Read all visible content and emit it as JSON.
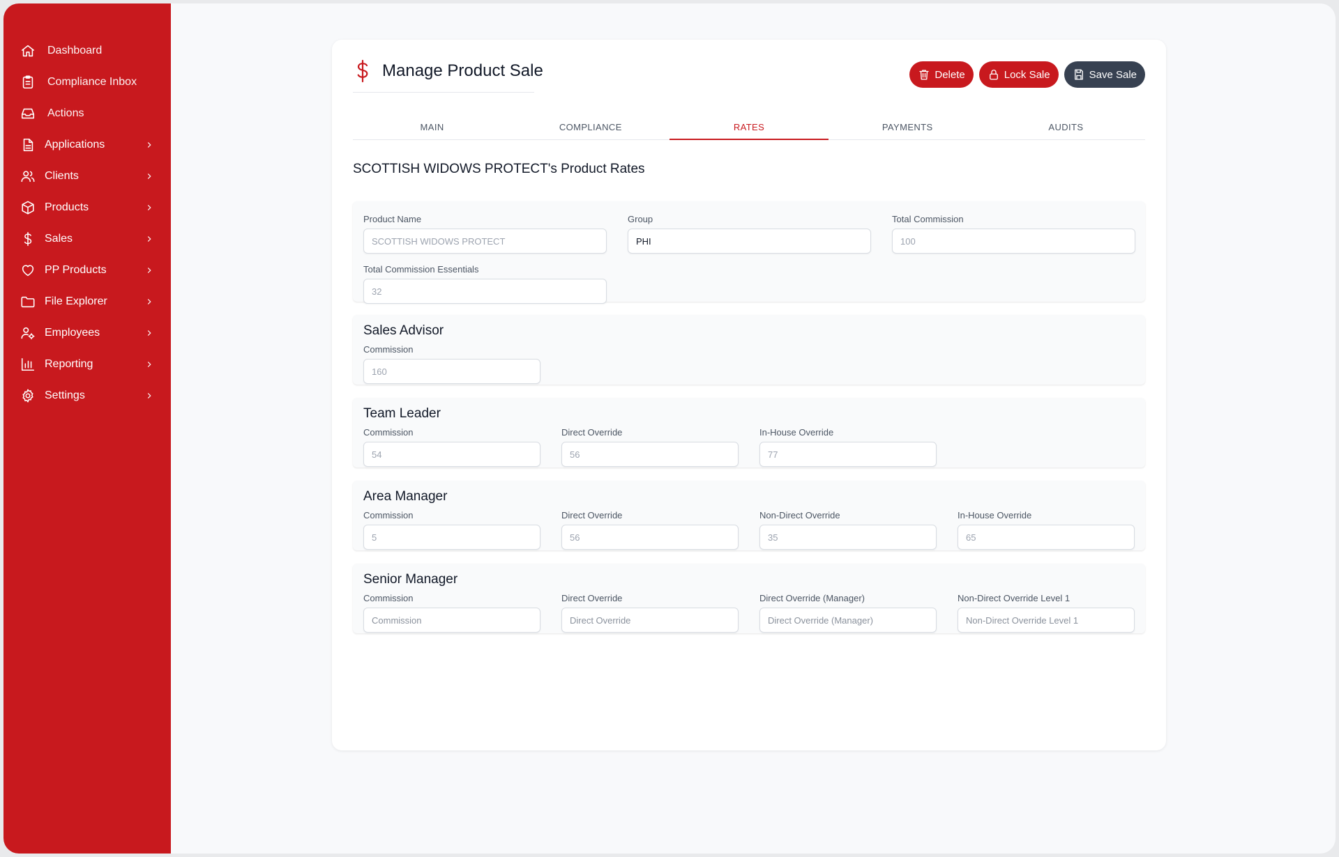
{
  "sidebar": {
    "items": [
      {
        "label": "Dashboard",
        "icon": "home-icon",
        "has_children": false
      },
      {
        "label": "Compliance Inbox",
        "icon": "clipboard-icon",
        "has_children": false
      },
      {
        "label": "Actions",
        "icon": "inbox-icon",
        "has_children": false
      },
      {
        "label": "Applications",
        "icon": "document-icon",
        "has_children": true
      },
      {
        "label": "Clients",
        "icon": "users-icon",
        "has_children": true
      },
      {
        "label": "Products",
        "icon": "cube-icon",
        "has_children": true
      },
      {
        "label": "Sales",
        "icon": "dollar-icon",
        "has_children": true
      },
      {
        "label": "PP Products",
        "icon": "heart-icon",
        "has_children": true
      },
      {
        "label": "File Explorer",
        "icon": "folder-icon",
        "has_children": true
      },
      {
        "label": "Employees",
        "icon": "user-cog-icon",
        "has_children": true
      },
      {
        "label": "Reporting",
        "icon": "bar-chart-icon",
        "has_children": true
      },
      {
        "label": "Settings",
        "icon": "gear-icon",
        "has_children": true
      }
    ]
  },
  "header": {
    "title": "Manage Product Sale",
    "icon": "dollar-icon",
    "buttons": {
      "delete": "Delete",
      "lock": "Lock Sale",
      "save": "Save Sale"
    }
  },
  "tabs": [
    {
      "label": "MAIN",
      "active": false
    },
    {
      "label": "COMPLIANCE",
      "active": false
    },
    {
      "label": "RATES",
      "active": true
    },
    {
      "label": "PAYMENTS",
      "active": false
    },
    {
      "label": "AUDITS",
      "active": false
    }
  ],
  "section_title": "SCOTTISH WIDOWS PROTECT's Product Rates",
  "product": {
    "name_label": "Product Name",
    "name_value": "SCOTTISH WIDOWS PROTECT",
    "group_label": "Group",
    "group_value": "PHI",
    "total_commission_label": "Total Commission",
    "total_commission_value": "100",
    "total_commission_essentials_label": "Total Commission Essentials",
    "total_commission_essentials_value": "32"
  },
  "sales_advisor": {
    "title": "Sales Advisor",
    "commission_label": "Commission",
    "commission_value": "160"
  },
  "team_leader": {
    "title": "Team Leader",
    "commission_label": "Commission",
    "commission_value": "54",
    "direct_override_label": "Direct Override",
    "direct_override_value": "56",
    "in_house_override_label": "In-House Override",
    "in_house_override_value": "77"
  },
  "area_manager": {
    "title": "Area Manager",
    "commission_label": "Commission",
    "commission_value": "5",
    "direct_override_label": "Direct Override",
    "direct_override_value": "56",
    "non_direct_override_label": "Non-Direct Override",
    "non_direct_override_value": "35",
    "in_house_override_label": "In-House Override",
    "in_house_override_value": "65"
  },
  "senior_manager": {
    "title": "Senior Manager",
    "commission_label": "Commission",
    "commission_placeholder": "Commission",
    "direct_override_label": "Direct Override",
    "direct_override_placeholder": "Direct Override",
    "direct_override_manager_label": "Direct Override (Manager)",
    "direct_override_manager_placeholder": "Direct Override (Manager)",
    "non_direct_override_l1_label": "Non-Direct Override Level 1",
    "non_direct_override_l1_placeholder": "Non-Direct Override Level 1"
  },
  "colors": {
    "brand_red": "#c8191e",
    "dark_button": "#374151"
  }
}
